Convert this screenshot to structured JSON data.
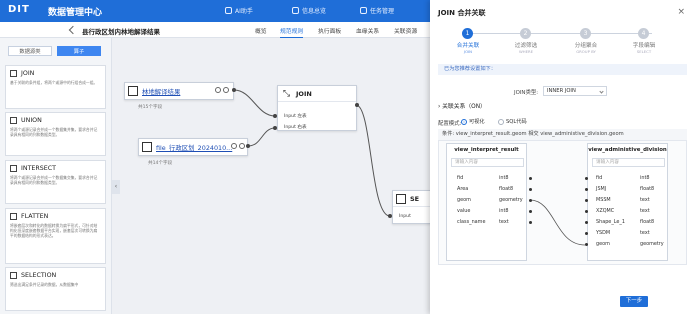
{
  "topbar": {
    "logo": "DIT",
    "app_title": "数据管理中心",
    "nav": [
      "AI助手",
      "信息总览",
      "任务管理"
    ]
  },
  "subbar": {
    "page_title": "县行政区划内林地解译结果",
    "tabs": [
      "概览",
      "规范规则",
      "执行面板",
      "血缘关系",
      "关联资源"
    ],
    "active_tab": 1
  },
  "left_panel": {
    "tabs": [
      "数据源类",
      "算子"
    ],
    "active_tab": 1,
    "operators": [
      {
        "name": "JOIN",
        "desc": "基于关联的条件组，将两个或源中的行组合成一组。"
      },
      {
        "name": "UNION",
        "desc": "将两个或源记录合并成一个数据集并集，要求合并记录具有相同的列和数据类型。"
      },
      {
        "name": "INTERSECT",
        "desc": "将两个或源记录合并成一个数据集交集，要求合并记录具有相同的列和数据类型。"
      },
      {
        "name": "FLATTEN",
        "desc": "将嵌套层次和转化的数据转换为扁平形式，可针对结构化但深度嵌套数据平台实现，嵌套层次可转换为扁平的数据结构的形式表达。"
      },
      {
        "name": "SELECTION",
        "desc": "筛选出满足条件记录的数据，从数据集中"
      }
    ]
  },
  "canvas": {
    "node1": {
      "title": "林地解译结果",
      "sub": "共15个字段"
    },
    "node2": {
      "title": "file_行政区划_2024010...",
      "sub": "共14个字段"
    },
    "join_node": {
      "title": "JOIN",
      "left_port": "Input 左表",
      "right_port": "Input 右表"
    },
    "sel_node": {
      "title": "SE",
      "port": "Input"
    }
  },
  "drawer": {
    "title": "JOIN 合并关联",
    "close": "×",
    "steps": [
      {
        "num": "1",
        "label": "合并关联",
        "sub": "JOIN"
      },
      {
        "num": "2",
        "label": "过滤筛选",
        "sub": "WHERE"
      },
      {
        "num": "3",
        "label": "分组聚合",
        "sub": "GROUP BY"
      },
      {
        "num": "4",
        "label": "字段编辑",
        "sub": "SELECT"
      }
    ],
    "banner": "已为您推荐设置如下：",
    "join_type_label": "JOIN类型:",
    "join_type_value": "INNER JOIN",
    "section": "关联关系（ON）",
    "mode_label": "配置模式:",
    "mode_visual": "可视化",
    "mode_sql": "SQL代码",
    "mode_selected": "visual",
    "condition": "条件: view_interpret_result.geom 相交 view_administive_division.geom",
    "left_table": {
      "name": "view_interpret_result",
      "search_placeholder": "请输入内容",
      "fields": [
        {
          "name": "fid",
          "type": "int8"
        },
        {
          "name": "Area",
          "type": "float8"
        },
        {
          "name": "geom",
          "type": "geometry"
        },
        {
          "name": "value",
          "type": "int8"
        },
        {
          "name": "class_name",
          "type": "text"
        }
      ]
    },
    "right_table": {
      "name": "view_administive_division",
      "search_placeholder": "请输入内容",
      "fields": [
        {
          "name": "fid",
          "type": "int8"
        },
        {
          "name": "JSMJ",
          "type": "float8"
        },
        {
          "name": "MSSM",
          "type": "text"
        },
        {
          "name": "XZQMC",
          "type": "text"
        },
        {
          "name": "Shape_Le_1",
          "type": "float8"
        },
        {
          "name": "YSDM",
          "type": "text"
        },
        {
          "name": "geom",
          "type": "geometry"
        }
      ]
    },
    "next_button": "下一步"
  }
}
